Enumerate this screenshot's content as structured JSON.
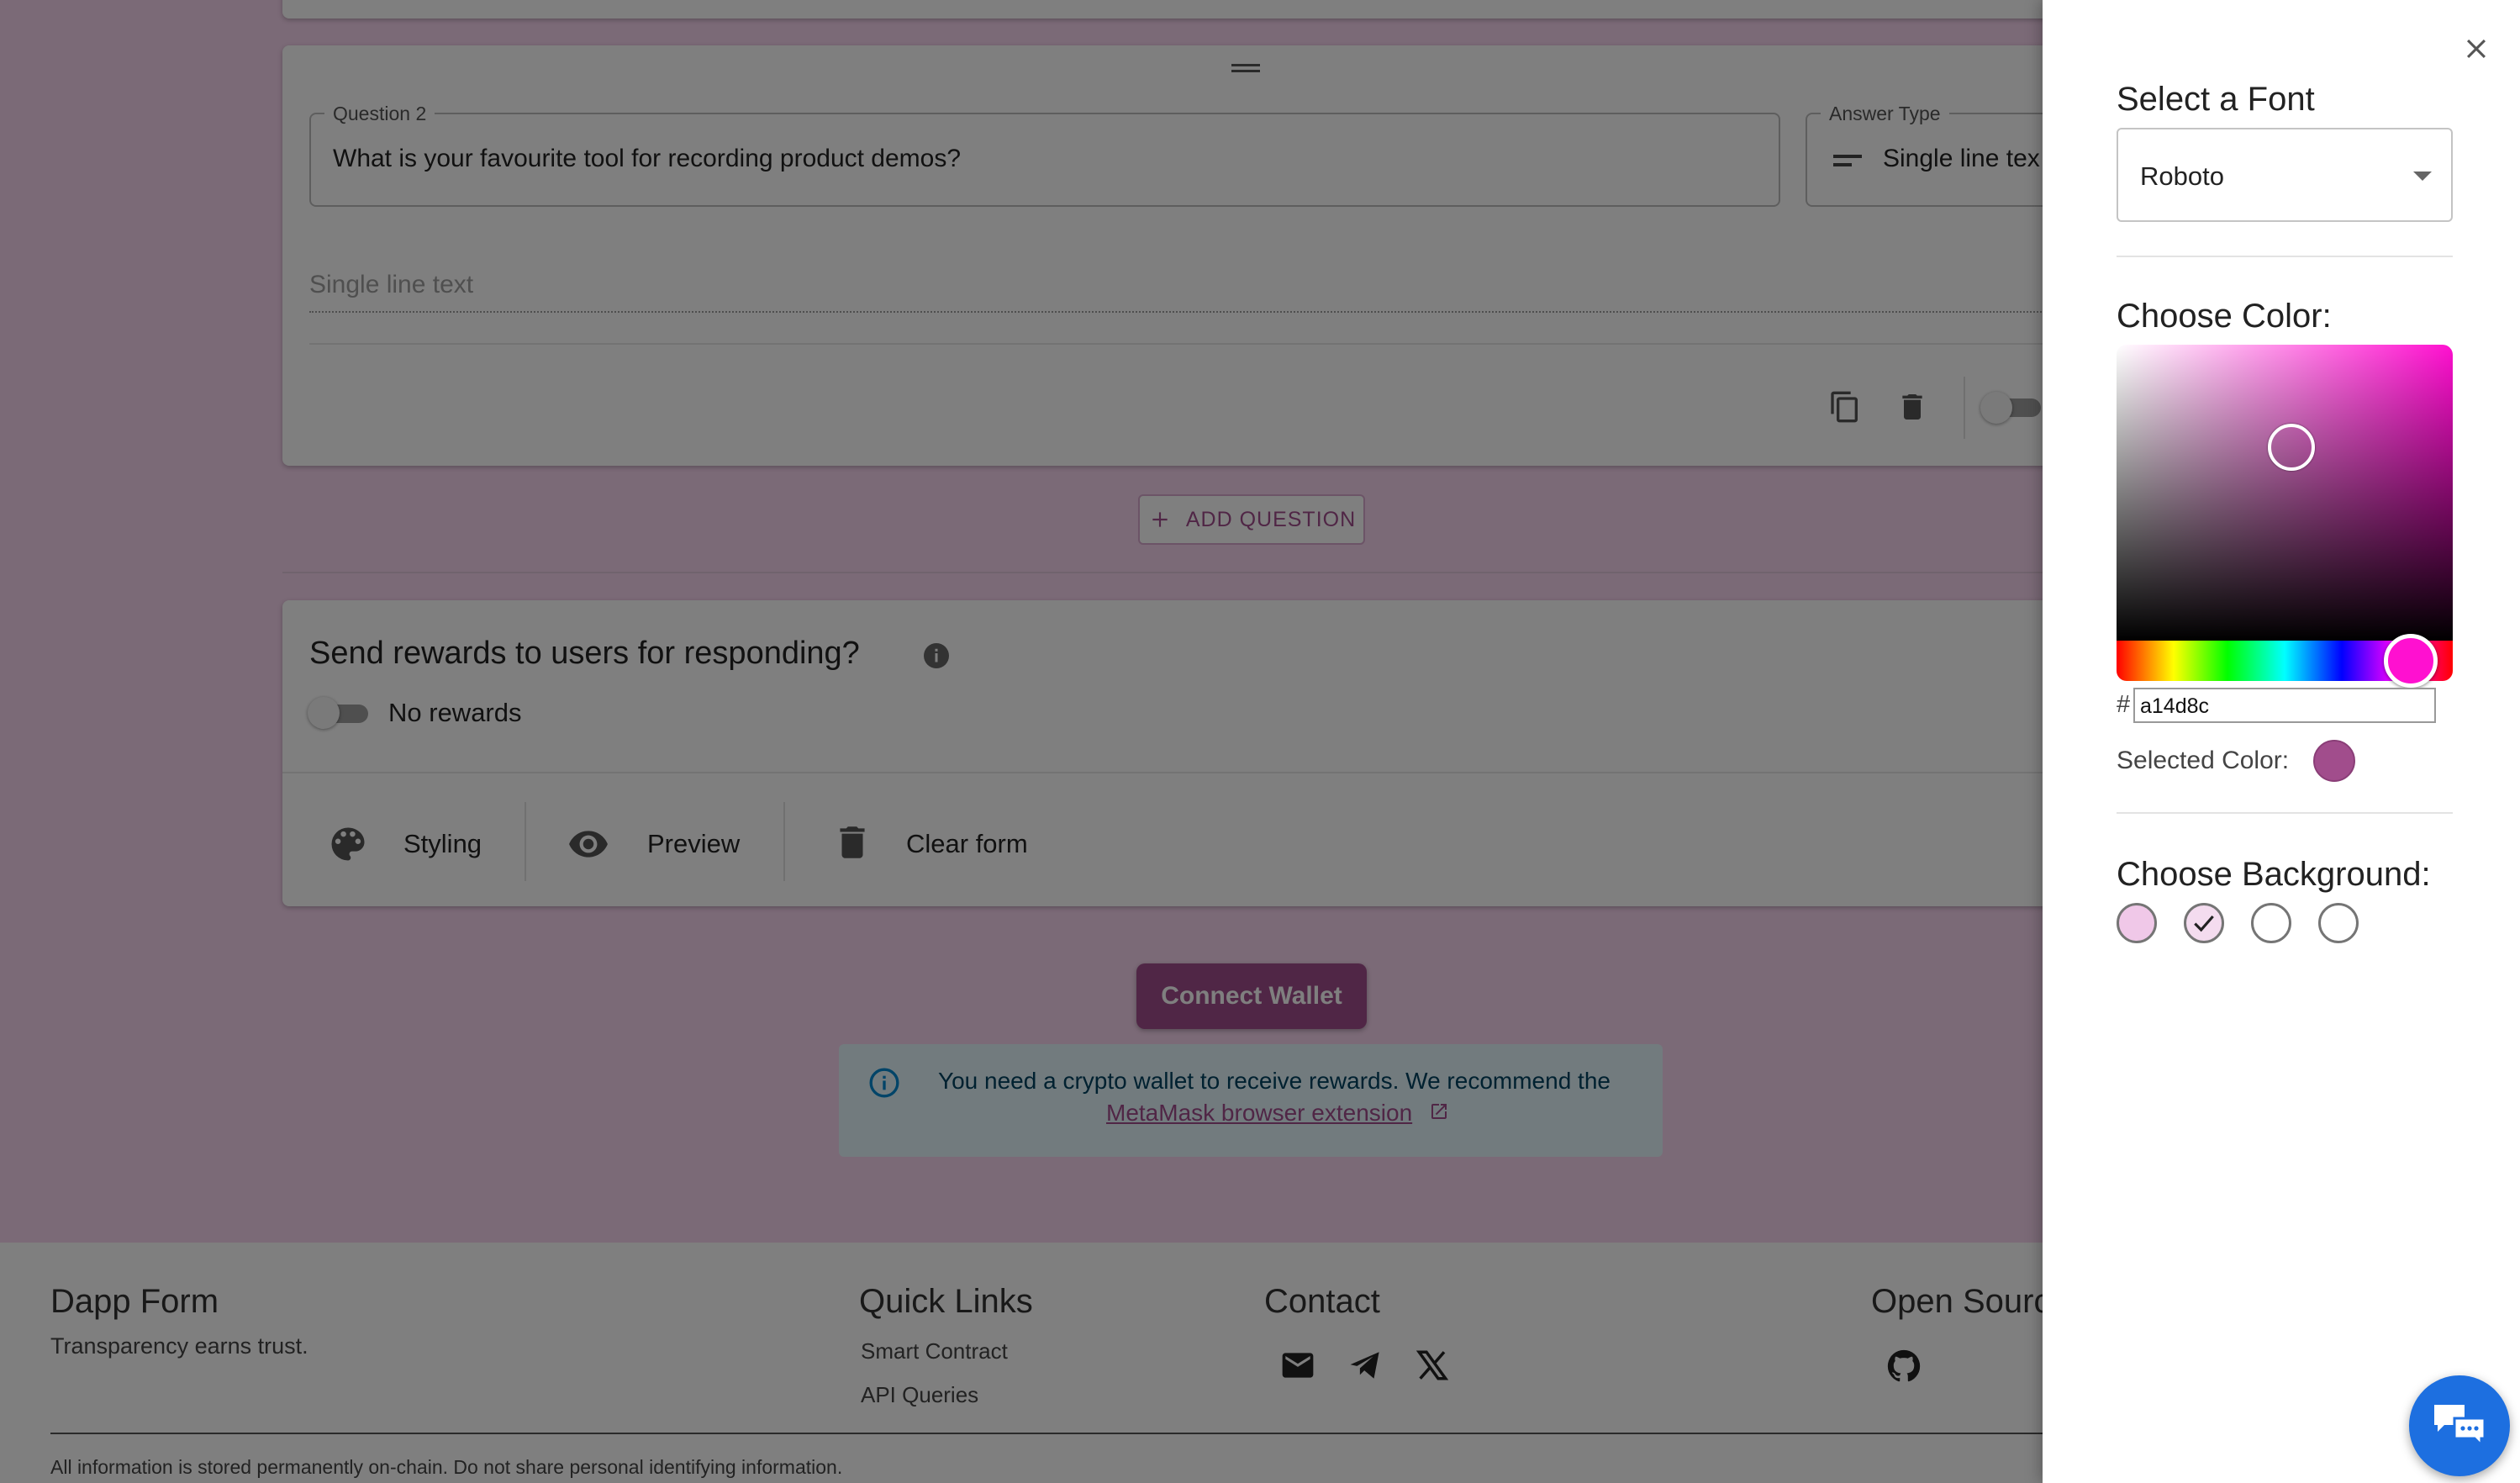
{
  "question_card": {
    "question_label": "Question 2",
    "question_value": "What is your favourite tool for recording product demos?",
    "answer_type_label": "Answer Type",
    "answer_type_value": "Single line tex",
    "answer_placeholder": "Single line text"
  },
  "add_question_label": "ADD QUESTION",
  "rewards": {
    "title": "Send rewards to users for responding?",
    "toggle_label": "No rewards"
  },
  "toolbar": {
    "styling_label": "Styling",
    "preview_label": "Preview",
    "clear_label": "Clear form"
  },
  "connect_wallet_label": "Connect Wallet",
  "wallet_notice": {
    "text": "You need a crypto wallet to receive rewards. We recommend the",
    "link_text": "MetaMask browser extension"
  },
  "footer": {
    "brand": "Dapp Form",
    "tagline": "Transparency earns trust.",
    "quick_links_title": "Quick Links",
    "quick_links": [
      "Smart Contract",
      "API Queries"
    ],
    "contact_title": "Contact",
    "open_source_title": "Open Sourc",
    "disclaimer": "All information is stored permanently on-chain. Do not share personal identifying information."
  },
  "drawer": {
    "font_title": "Select a Font",
    "font_value": "Roboto",
    "color_title": "Choose Color:",
    "hex_prefix": "#",
    "hex_value": "a14d8c",
    "selected_color_label": "Selected Color:",
    "background_title": "Choose Background:"
  },
  "colors": {
    "selected_color": "#a14d8c",
    "accent_button": "#a14d8c",
    "page_background": "#f6d4ee",
    "hue_thumb": "#ff10d0",
    "background_options": [
      "#f0c8e8",
      "#f4dcef",
      "#ffffff",
      "#ffffff"
    ],
    "chat_button": "#1d6fe0"
  },
  "icons": [
    "drag-handle-icon",
    "short-text-icon",
    "copy-icon",
    "delete-icon",
    "plus-icon",
    "info-icon",
    "palette-icon",
    "eye-icon",
    "trash-icon",
    "info-outline-icon",
    "external-link-icon",
    "mail-icon",
    "telegram-icon",
    "x-icon",
    "github-icon",
    "close-icon",
    "dropdown-arrow-icon",
    "check-icon",
    "chat-icon"
  ]
}
